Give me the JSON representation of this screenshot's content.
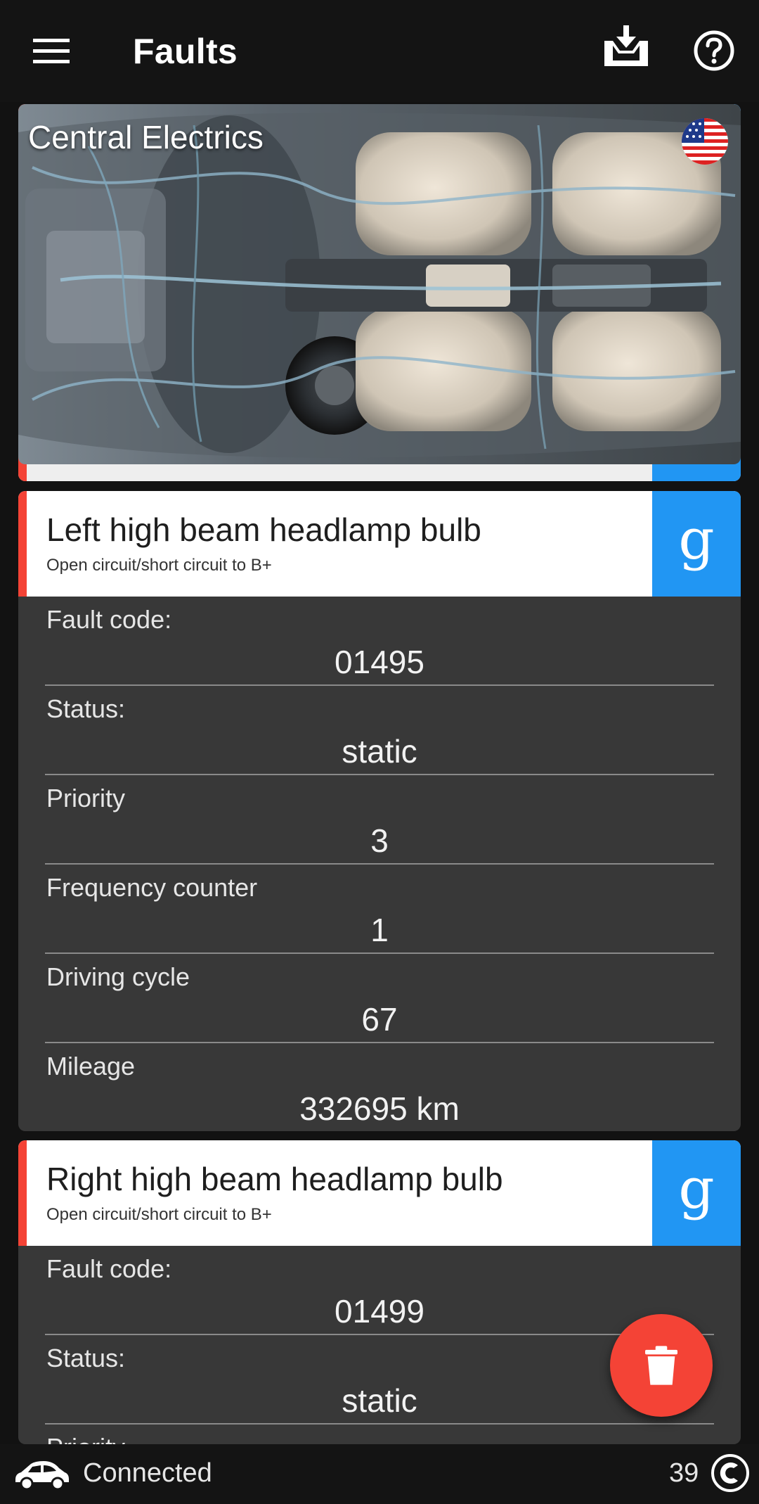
{
  "app": {
    "title": "Faults",
    "icons": {
      "menu": "menu-icon",
      "download": "download-tray-icon",
      "help": "help-circle-icon"
    }
  },
  "header": {
    "title": "Central Electrics",
    "flag": "us-flag-icon"
  },
  "faults": [
    {
      "name": "Left high beam headlamp bulb",
      "description": "Open circuit/short circuit to B+",
      "search_label": "g",
      "fields": [
        {
          "label": "Fault code:",
          "value": "01495"
        },
        {
          "label": "Status:",
          "value": "static"
        },
        {
          "label": "Priority",
          "value": "3"
        },
        {
          "label": "Frequency counter",
          "value": "1"
        },
        {
          "label": "Driving cycle",
          "value": "67"
        },
        {
          "label": "Mileage",
          "value": "332695 km"
        }
      ]
    },
    {
      "name": "Right high beam headlamp bulb",
      "description": "Open circuit/short circuit to B+",
      "search_label": "g",
      "fields": [
        {
          "label": "Fault code:",
          "value": "01499"
        },
        {
          "label": "Status:",
          "value": "static"
        },
        {
          "label": "Priority",
          "value": ""
        }
      ]
    }
  ],
  "fab": {
    "icon": "trash-icon"
  },
  "status_bar": {
    "connection": "Connected",
    "count": "39",
    "car_icon": "car-icon",
    "connection_icon": "connection-c-icon"
  },
  "colors": {
    "accent_red": "#f44336",
    "accent_blue": "#2196f3",
    "card_bg": "#383838",
    "page_bg": "#121212"
  }
}
